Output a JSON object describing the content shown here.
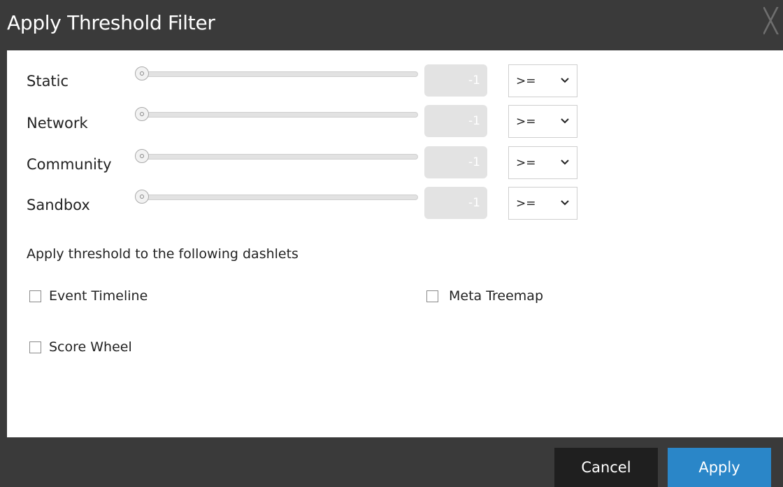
{
  "dialog": {
    "title": "Apply Threshold Filter",
    "close_glyph": "╳"
  },
  "filters": [
    {
      "label": "Static",
      "value": "-1",
      "operator": ">=",
      "slider_fraction": 0.0
    },
    {
      "label": "Network",
      "value": "-1",
      "operator": ">=",
      "slider_fraction": 0.0
    },
    {
      "label": "Community",
      "value": "-1",
      "operator": ">=",
      "slider_fraction": 0.0
    },
    {
      "label": "Sandbox",
      "value": "-1",
      "operator": ">=",
      "slider_fraction": 0.0
    }
  ],
  "dashlets": {
    "heading": "Apply threshold to the following dashlets",
    "items": [
      {
        "label": "Event Timeline",
        "checked": false
      },
      {
        "label": "Meta Treemap",
        "checked": false
      },
      {
        "label": "Score Wheel",
        "checked": false
      }
    ]
  },
  "footer": {
    "cancel_label": "Cancel",
    "apply_label": "Apply"
  },
  "colors": {
    "title_bar": "#3a3a3a",
    "apply_button": "#2a86c8",
    "cancel_button": "#1f1f1f"
  }
}
